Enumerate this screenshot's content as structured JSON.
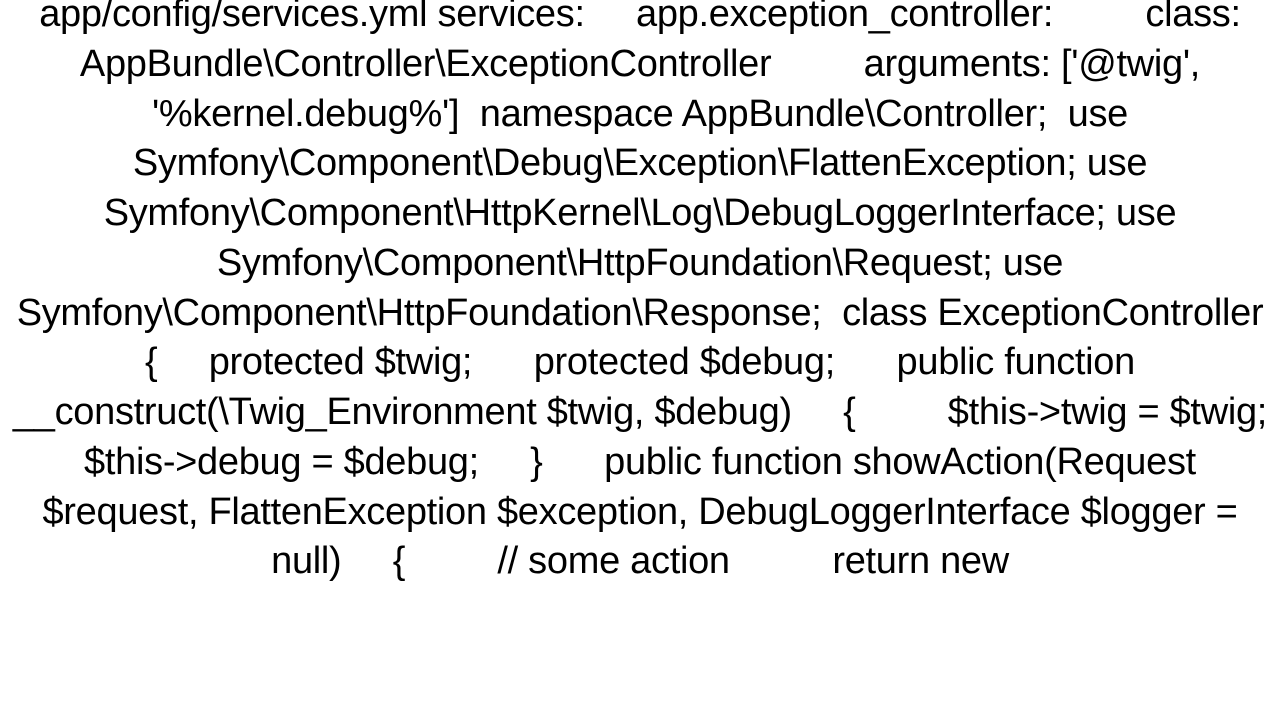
{
  "code_text": "app/config/services.yml services:     app.exception_controller:         class: AppBundle\\Controller\\ExceptionController         arguments: ['@twig', '%kernel.debug%']  namespace AppBundle\\Controller;  use Symfony\\Component\\Debug\\Exception\\FlattenException; use Symfony\\Component\\HttpKernel\\Log\\DebugLoggerInterface; use Symfony\\Component\\HttpFoundation\\Request; use Symfony\\Component\\HttpFoundation\\Response;  class ExceptionController {     protected $twig;      protected $debug;      public function __construct(\\Twig_Environment $twig, $debug)     {         $this->twig = $twig;         $this->debug = $debug;     }      public function showAction(Request $request, FlattenException $exception, DebugLoggerInterface $logger = null)     {         // some action          return new"
}
